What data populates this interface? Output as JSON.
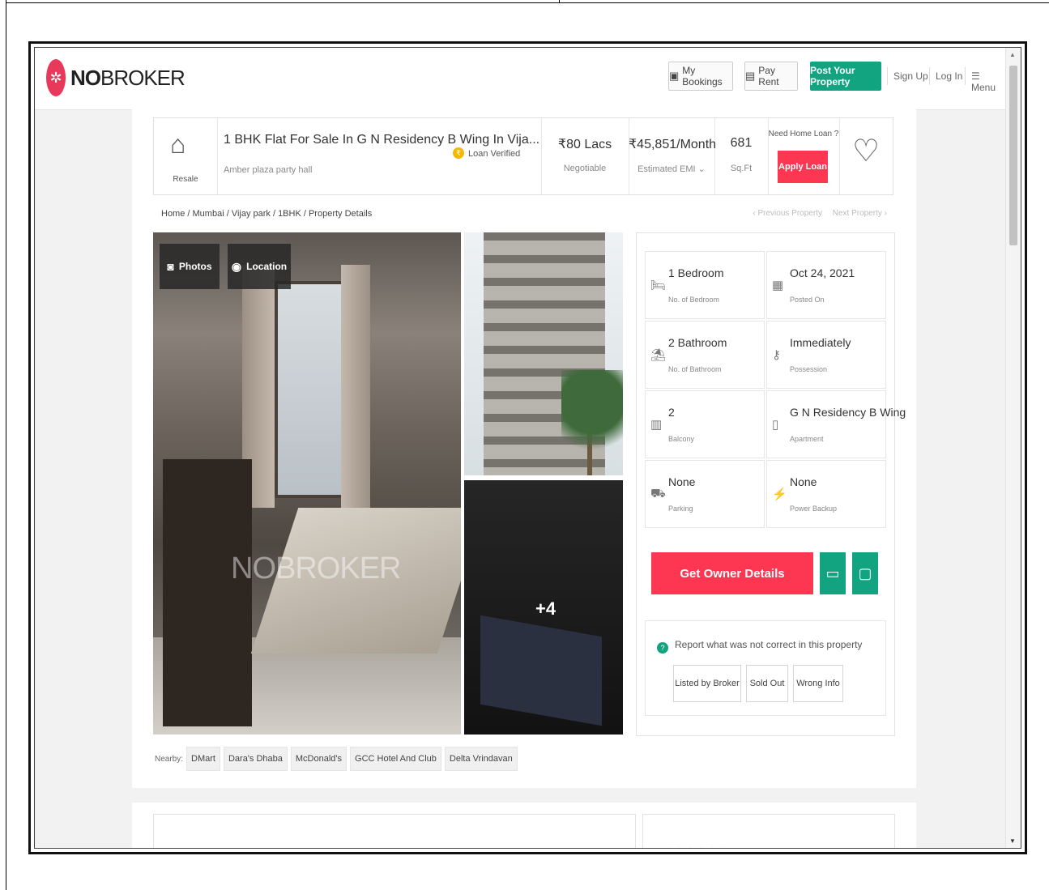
{
  "navbar": {
    "logo": {
      "prefix": "NO",
      "suffix": "BROKER"
    },
    "my_bookings": "My Bookings",
    "pay_rent": "Pay Rent",
    "post_property": "Post Your Property",
    "sign_up": "Sign Up",
    "log_in": "Log In",
    "menu": "Menu"
  },
  "property": {
    "type_label": "Resale",
    "title": "1 BHK Flat For Sale In G N Residency B Wing In Vija...",
    "subtitle": "Amber plaza party hall",
    "loan_verified": "Loan Verified",
    "price": "₹80 Lacs",
    "price_note": "Negotiable",
    "emi": "₹45,851/Month",
    "emi_note": "Estimated EMI ⌄",
    "area": "681",
    "area_unit": "Sq.Ft",
    "need_loan": "Need Home Loan ?",
    "apply_loan": "Apply Loan"
  },
  "breadcrumb": "Home / Mumbai / Vijay park / 1BHK / Property Details",
  "prev_property": "‹ Previous Property",
  "next_property": "Next Property ›",
  "gallery": {
    "photos_label": "Photos",
    "location_label": "Location",
    "watermark": "NOBROKER",
    "more_count": "+4"
  },
  "specs": [
    {
      "icon": "bed-icon",
      "value": "1 Bedroom",
      "label": "No. of Bedroom"
    },
    {
      "icon": "calendar-icon",
      "value": "Oct 24, 2021",
      "label": "Posted On"
    },
    {
      "icon": "bath-icon",
      "value": "2 Bathroom",
      "label": "No. of Bathroom"
    },
    {
      "icon": "key-icon",
      "value": "Immediately",
      "label": "Possession"
    },
    {
      "icon": "balcony-icon",
      "value": "2",
      "label": "Balcony"
    },
    {
      "icon": "building-icon",
      "value": "G N Residency B Wing",
      "label": "Apartment"
    },
    {
      "icon": "car-icon",
      "value": "None",
      "label": "Parking"
    },
    {
      "icon": "power-icon",
      "value": "None",
      "label": "Power Backup"
    }
  ],
  "actions": {
    "owner_details": "Get Owner Details"
  },
  "report": {
    "text": "Report what was not correct in this property",
    "listed_by_broker": "Listed by Broker",
    "sold_out": "Sold Out",
    "wrong_info": "Wrong Info"
  },
  "nearby": {
    "label": "Nearby:",
    "places": [
      "DMart",
      "Dara's Dhaba",
      "McDonald's",
      "GCC Hotel And Club",
      "Delta Vrindavan"
    ]
  },
  "colors": {
    "brand_red": "#fd3752",
    "brand_green": "#12a381"
  }
}
